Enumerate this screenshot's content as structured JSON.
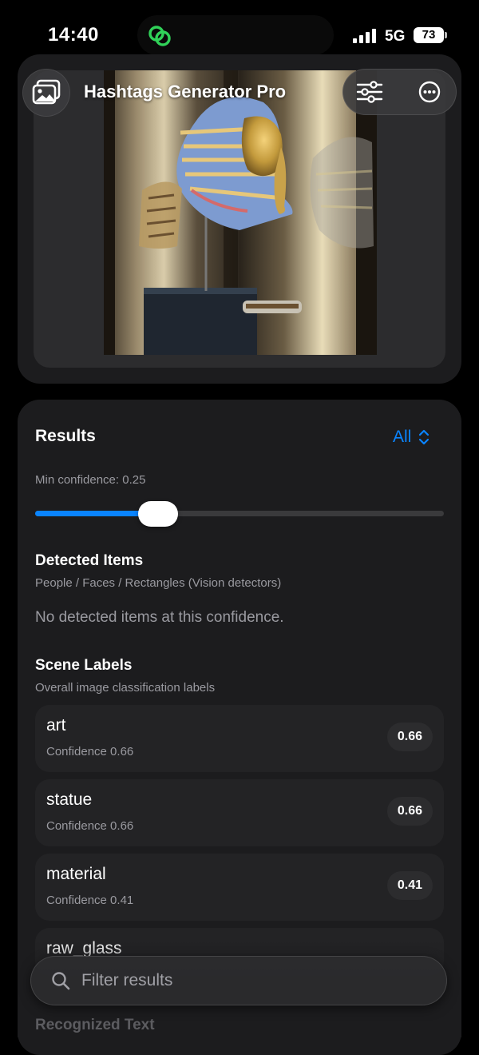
{
  "status_bar": {
    "time": "14:40",
    "network": "5G",
    "battery": "73",
    "island_icon": "link-rings-icon"
  },
  "header": {
    "title": "Hashtags Generator Pro",
    "left_button_icon": "photo-library-icon",
    "right_buttons": [
      "sliders-icon",
      "more-ellipsis-icon"
    ]
  },
  "results": {
    "title": "Results",
    "filter": "All",
    "min_confidence_label": "Min confidence: 0.25",
    "min_confidence": 0.25,
    "detected_items": {
      "title": "Detected Items",
      "subtitle": "People / Faces / Rectangles (Vision detectors)",
      "empty_message": "No detected items at this confidence."
    },
    "scene_labels": {
      "title": "Scene Labels",
      "subtitle": "Overall image classification labels",
      "items": [
        {
          "name": "art",
          "confidence_text": "Confidence 0.66",
          "badge": "0.66"
        },
        {
          "name": "statue",
          "confidence_text": "Confidence 0.66",
          "badge": "0.66"
        },
        {
          "name": "material",
          "confidence_text": "Confidence 0.41",
          "badge": "0.41"
        },
        {
          "name": "raw_glass",
          "confidence_text": "",
          "badge": ""
        }
      ]
    },
    "recognized_text_title": "Recognized Text"
  },
  "search": {
    "placeholder": "Filter results"
  },
  "colors": {
    "accent": "#0a84ff",
    "card": "#1c1c1e",
    "secondary_text": "#9a9aa0",
    "island_icon": "#30d158"
  }
}
